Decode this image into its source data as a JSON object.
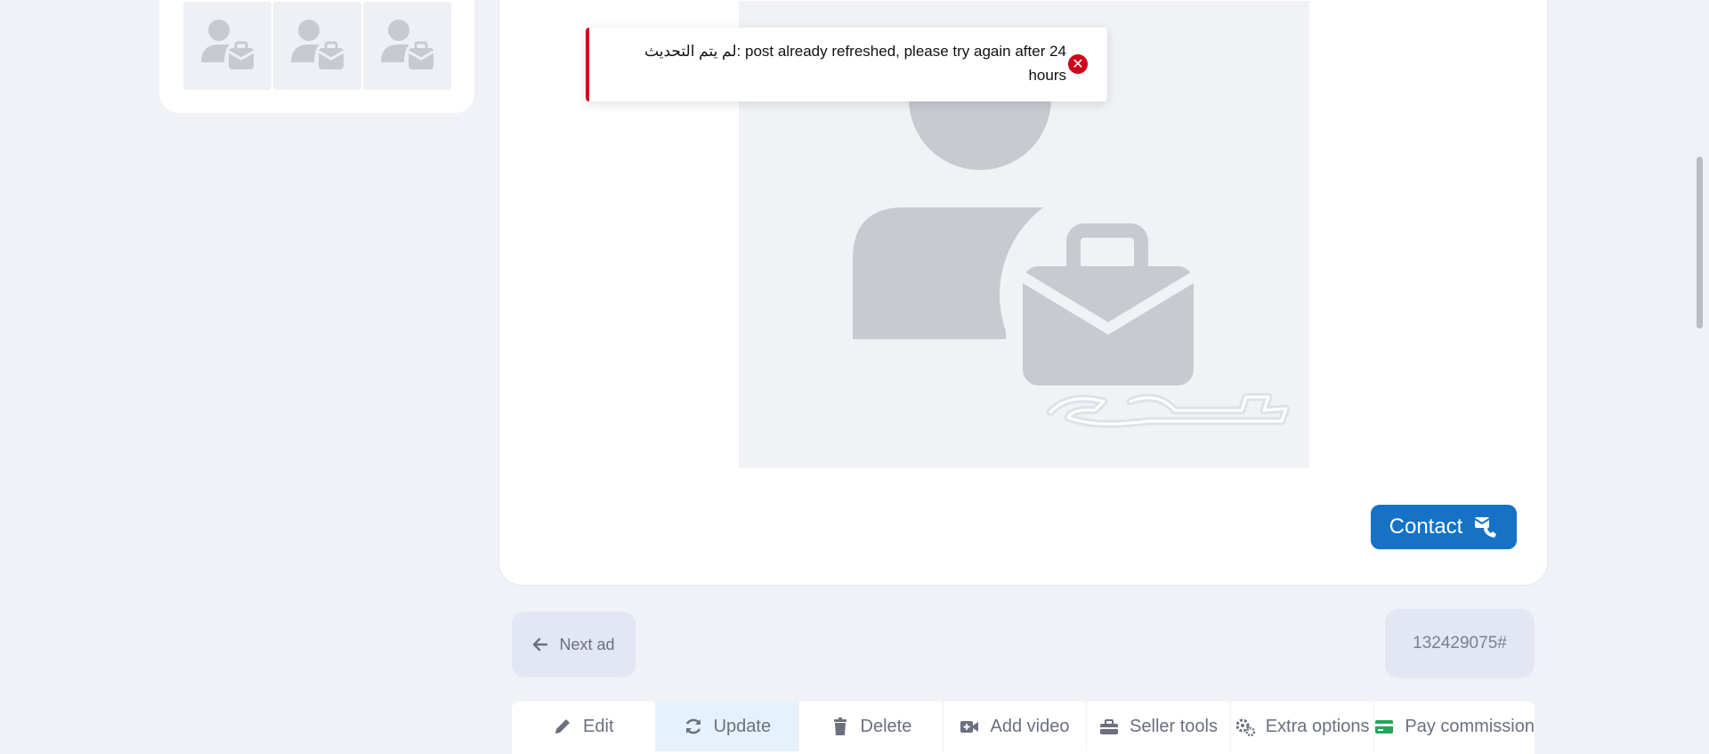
{
  "toast": {
    "message_line1": "لم يتم التحديث: post already refreshed, please try again after 24",
    "message_line2": "hours",
    "close_symbol": "✕",
    "accent_color": "#d0021b"
  },
  "main": {
    "contact_label": "Contact",
    "contact_color": "#1572c5"
  },
  "nav": {
    "next_ad_label": "Next ad",
    "ad_id": "132429075#"
  },
  "toolbar": {
    "items": [
      {
        "label": "Edit",
        "icon": "pencil-icon"
      },
      {
        "label": "Update",
        "icon": "refresh-icon"
      },
      {
        "label": "Delete",
        "icon": "trash-icon"
      },
      {
        "label": "Add video",
        "icon": "video-camera-icon"
      },
      {
        "label": "Seller tools",
        "icon": "toolbox-icon"
      },
      {
        "label": "Extra options",
        "icon": "gears-icon"
      },
      {
        "label": "Pay commission",
        "icon": "credit-card-icon"
      }
    ]
  },
  "side": {
    "thumbnail_count": 3
  }
}
